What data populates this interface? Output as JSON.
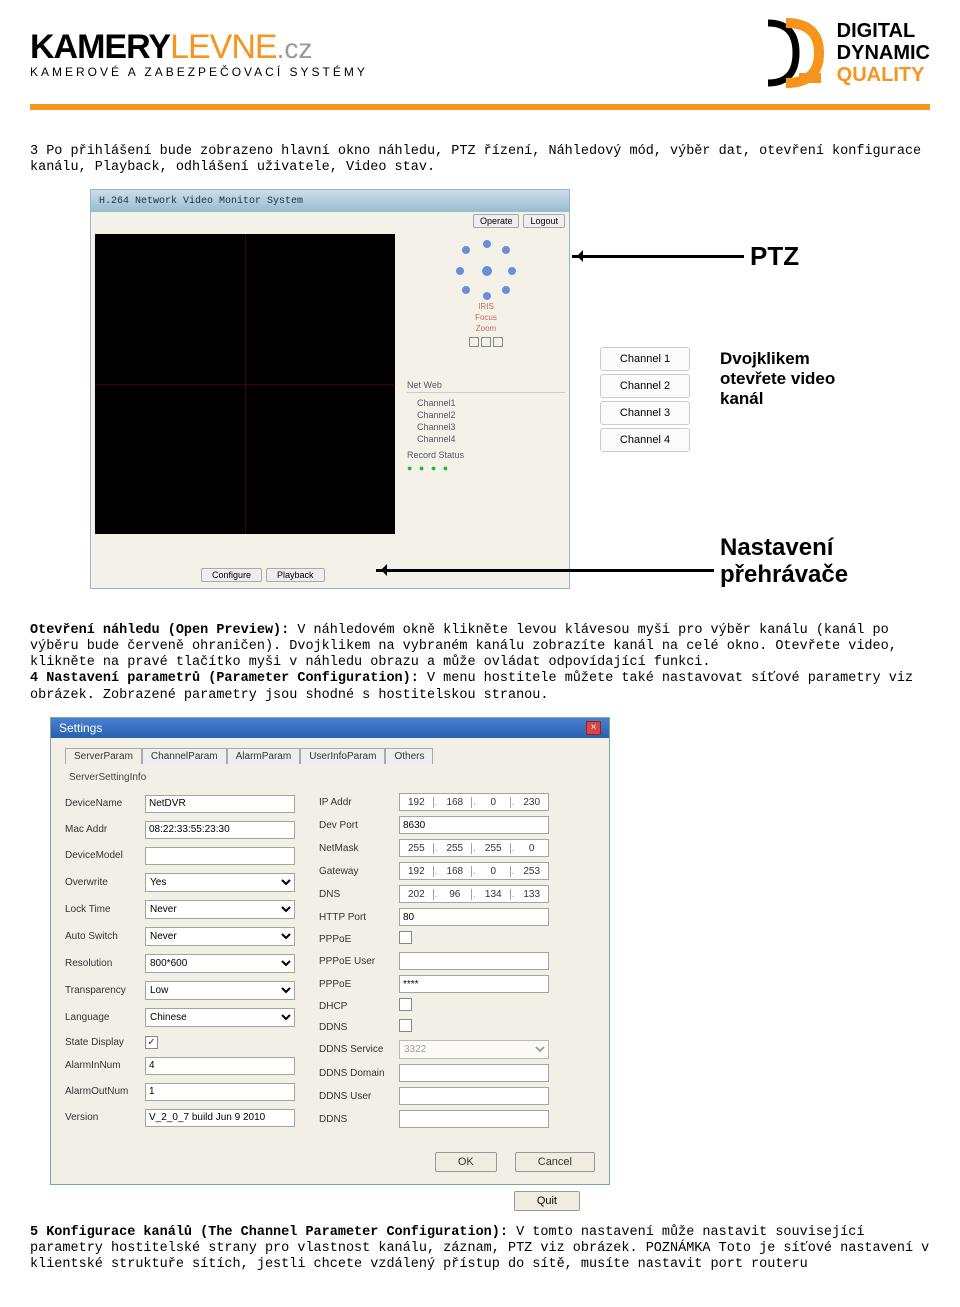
{
  "header": {
    "logo_kamery": "KAMERY",
    "logo_levne": "LEVNE",
    "logo_cz": ".cz",
    "logo_sub": "KAMEROVÉ A ZABEZPEČOVACÍ SYSTÉMY",
    "ddq1": "DIGITAL",
    "ddq2": "DYNAMIC",
    "ddq3": "QUALITY"
  },
  "para3": "3 Po přihlášení bude zobrazeno hlavní okno náhledu, PTZ řízení, Náhledový mód, výběr dat, otevření konfigurace kanálu, Playback, odhlášení uživatele, Video stav.",
  "fig1": {
    "titlebar": "H.264 Network Video Monitor System",
    "top_btn1": "Operate",
    "top_btn2": "Logout",
    "ctrl1": "IRIS",
    "ctrl2": "Focus",
    "ctrl3": "Zoom",
    "chan_hdr": "Net Web",
    "chanitems": [
      "Channel1",
      "Channel2",
      "Channel3",
      "Channel4"
    ],
    "status_label": "Record Status",
    "bottom1": "Configure",
    "bottom2": "Playback",
    "side_channels": [
      "Channel 1",
      "Channel 2",
      "Channel 3",
      "Channel 4"
    ],
    "annot_ptz": "PTZ",
    "annot_dbl": "Dvojklikem otevřete video kanál",
    "annot_nast": "Nastavení přehrávače"
  },
  "open_preview_bold": "Otevření náhledu (Open Preview):",
  "open_preview_text": " V náhledovém okně klikněte levou klávesou myši pro výběr kanálu (kanál po výběru bude červeně ohraničen). Dvojklikem na vybraném kanálu zobrazíte kanál na celé okno. Otevřete video, klikněte na pravé tlačítko myši v náhledu obrazu a může ovládat odpovídající funkci.",
  "param_bold": "4 Nastavení parametrů (Parameter Configuration):",
  "param_text": " V menu hostitele můžete také nastavovat síťové parametry viz obrázek. Zobrazené parametry jsou shodné s hostitelskou stranou.",
  "fig2": {
    "title": "Settings",
    "tabs": [
      "ServerParam",
      "ChannelParam",
      "AlarmParam",
      "UserInfoParam",
      "Others"
    ],
    "group": "ServerSettingInfo",
    "left": {
      "DeviceName_l": "DeviceName",
      "DeviceName_v": "NetDVR",
      "MacAddr_l": "Mac Addr",
      "MacAddr_v": "08:22:33:55:23:30",
      "DeviceModel_l": "DeviceModel",
      "DeviceModel_v": "",
      "Overwrite_l": "Overwrite",
      "Overwrite_v": "Yes",
      "LockTime_l": "Lock Time",
      "LockTime_v": "Never",
      "AutoSwitch_l": "Auto Switch",
      "AutoSwitch_v": "Never",
      "Resolution_l": "Resolution",
      "Resolution_v": "800*600",
      "Transparency_l": "Transparency",
      "Transparency_v": "Low",
      "Language_l": "Language",
      "Language_v": "Chinese",
      "StateDisplay_l": "State Display",
      "AlarmInNum_l": "AlarmInNum",
      "AlarmInNum_v": "4",
      "AlarmOutNum_l": "AlarmOutNum",
      "AlarmOutNum_v": "1",
      "Version_l": "Version",
      "Version_v": "V_2_0_7 build Jun 9 2010"
    },
    "right": {
      "IPAddr_l": "IP Addr",
      "IPAddr_v": [
        "192",
        "168",
        "0",
        "230"
      ],
      "DevPort_l": "Dev Port",
      "DevPort_v": "8630",
      "NetMask_l": "NetMask",
      "NetMask_v": [
        "255",
        "255",
        "255",
        "0"
      ],
      "Gateway_l": "Gateway",
      "Gateway_v": [
        "192",
        "168",
        "0",
        "253"
      ],
      "DNS_l": "DNS",
      "DNS_v": [
        "202",
        "96",
        "134",
        "133"
      ],
      "HTTPPort_l": "HTTP Port",
      "HTTPPort_v": "80",
      "PPPoE_l": "PPPoE",
      "PPPoEUser_l": "PPPoE User",
      "PPPoEUser_v": "",
      "PPPoEPass_l": "PPPoE",
      "PPPoEPass_v": "****",
      "DHCP_l": "DHCP",
      "DDNS_l": "DDNS",
      "DDNSService_l": "DDNS Service",
      "DDNSService_v": "3322",
      "DDNSDomain_l": "DDNS Domain",
      "DDNSDomain_v": "",
      "DDNSUser_l": "DDNS User",
      "DDNSUser_v": "",
      "DDNS2_l": "DDNS",
      "DDNS2_v": ""
    },
    "btn_ok": "OK",
    "btn_cancel": "Cancel",
    "btn_quit": "Quit"
  },
  "chan_conf_bold": "5 Konfigurace kanálů (The Channel Parameter Configuration):",
  "chan_conf_text": " V tomto nastavení může nastavit související parametry hostitelské strany pro vlastnost kanálu, záznam, PTZ viz obrázek. POZNÁMKA Toto je síťové nastavení v klientské struktuře sítích, jestli chcete vzdálený přístup do sítě, musíte nastavit port routeru"
}
